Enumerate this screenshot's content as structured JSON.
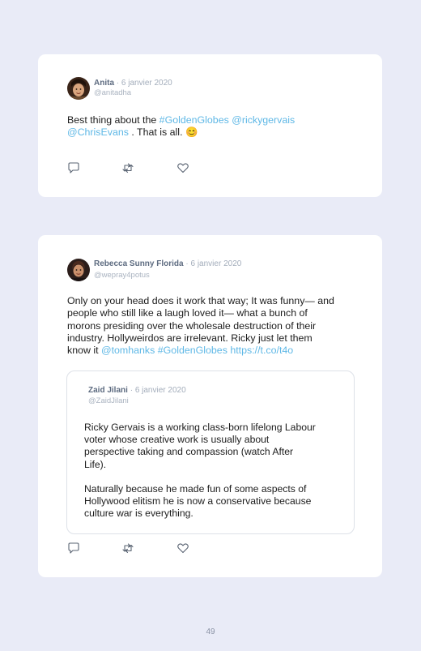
{
  "tweet1": {
    "author": "Anita",
    "sep": "·",
    "date": "6 janvier 2020",
    "handle": "@anitadha",
    "text_parts": {
      "t1": "Best thing about the ",
      "l1": "#GoldenGlobes",
      "t2": " ",
      "l2": "@rickygervais",
      "l3": "@ChrisEvans",
      "t3": " . That is all. 😊"
    },
    "actions": {
      "reply": "reply-icon",
      "retweet": "retweet-icon",
      "like": "heart-icon"
    }
  },
  "tweet2": {
    "author": "Rebecca Sunny Florida",
    "sep": "·",
    "date": "6 janvier 2020",
    "handle": "@wepray4potus",
    "text_parts": {
      "line1": "Only on your head does it work that way; It was funny— and",
      "line2": "people who still like a laugh loved it— what a bunch of",
      "line3": "morons presiding over the wholesale destruction of their",
      "line4": "industry. Hollyweirdos are irrelevant. Ricky just let them",
      "line5a": "know it ",
      "l1": "@tomhanks",
      "sp1": " ",
      "l2": "#GoldenGlobes",
      "sp2": " ",
      "l3": "https://t.co/t4o"
    },
    "quote": {
      "author": "Zaid Jilani",
      "sep": "·",
      "date": "6 janvier 2020",
      "handle": "@ZaidJilani",
      "para1": {
        "line1": "Ricky Gervais is a working class-born lifelong Labour",
        "line2": "voter whose creative work is usually about",
        "line3": "perspective taking and compassion (watch After",
        "line4": "Life)."
      },
      "para2": {
        "line1": "Naturally because he made fun of some aspects of",
        "line2": "Hollywood elitism he is now a conservative because",
        "line3": "culture war is everything."
      }
    },
    "actions": {
      "reply": "reply-icon",
      "retweet": "retweet-icon",
      "like": "heart-icon"
    }
  },
  "page_number": "49",
  "colors": {
    "background": "#e9ebf7",
    "card": "#ffffff",
    "link": "#5fb8e6",
    "name": "#5d6b80",
    "meta": "#a3adbb"
  }
}
